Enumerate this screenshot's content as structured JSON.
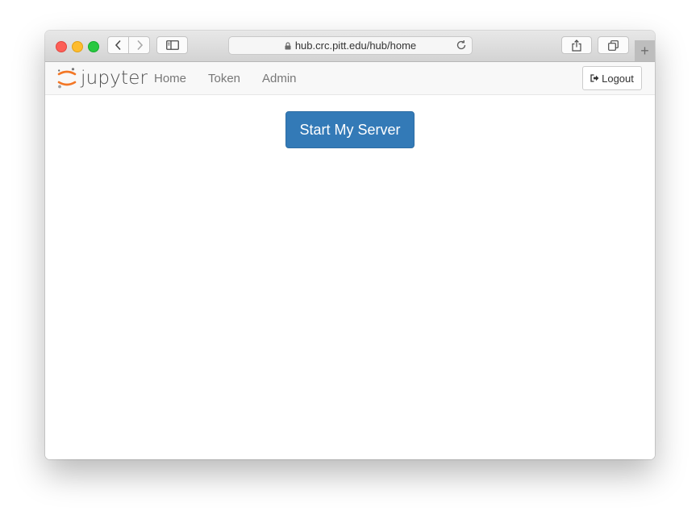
{
  "browser": {
    "url": "hub.crc.pitt.edu/hub/home",
    "icons": {
      "back": "chevron-left-icon",
      "forward": "chevron-right-icon",
      "sidebar": "sidebar-icon",
      "lock": "lock-icon",
      "reload": "reload-icon",
      "share": "share-icon",
      "tabs": "tabs-icon",
      "new_tab": "plus-icon"
    },
    "new_tab_glyph": "+"
  },
  "navbar": {
    "brand": "jupyter",
    "links": [
      "Home",
      "Token",
      "Admin"
    ],
    "logout_label": "Logout",
    "logo_accent": "#f37726"
  },
  "main": {
    "start_button_label": "Start My Server",
    "button_color": "#337ab7"
  }
}
